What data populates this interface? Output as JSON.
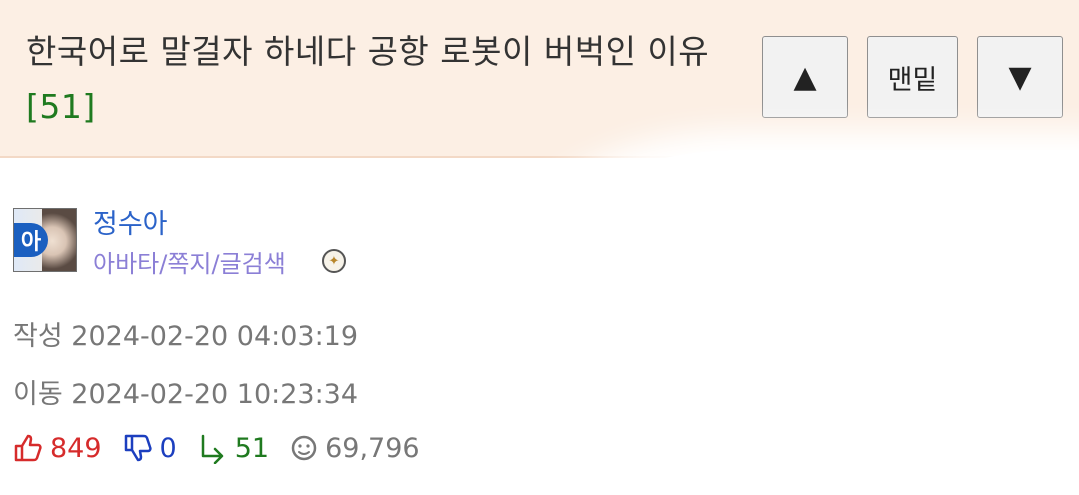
{
  "post": {
    "title": "한국어로 말걸자 하네다 공항 로봇이 버벅인 이유",
    "comment_count": "[51]"
  },
  "nav": {
    "up_label": "▲",
    "bottom_label": "맨밑",
    "down_label": "▼"
  },
  "author": {
    "avatar_letter": "아",
    "nickname": "정수아",
    "links": "아바타/쪽지/글검색",
    "level_icon": "level-badge-icon"
  },
  "meta": {
    "written_label": "작성",
    "written_time": "2024-02-20 04:03:19",
    "moved_label": "이동",
    "moved_time": "2024-02-20 10:23:34"
  },
  "stats": {
    "upvotes": "849",
    "downvotes": "0",
    "replies": "51",
    "views": "69,796"
  },
  "colors": {
    "header_bg": "#fcefe4",
    "upvote": "#d62b2b",
    "downvote": "#1c3fbf",
    "reply": "#1f7a1f",
    "nickname": "#2b63c9",
    "links": "#8b7fd6"
  }
}
